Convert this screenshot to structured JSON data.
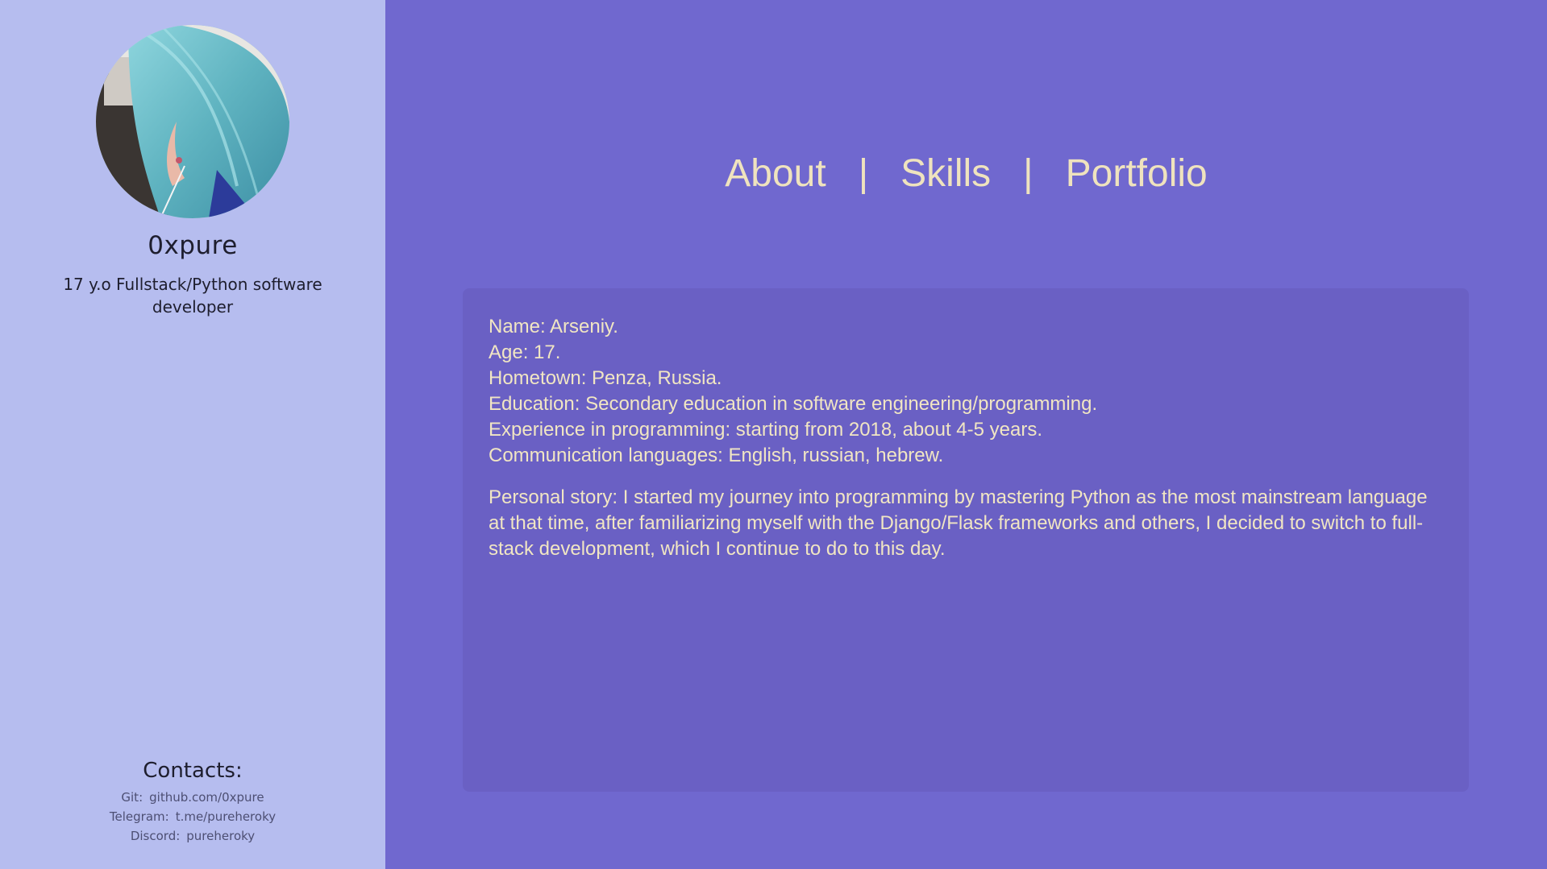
{
  "profile": {
    "username": "0xpure",
    "tagline": "17 y.o Fullstack/Python software developer"
  },
  "contacts": {
    "title": "Contacts:",
    "items": [
      {
        "label": "Git:",
        "value": "github.com/0xpure"
      },
      {
        "label": "Telegram:",
        "value": "t.me/pureheroky"
      },
      {
        "label": "Discord:",
        "value": "pureheroky"
      }
    ]
  },
  "nav": {
    "items": [
      "About",
      "Skills",
      "Portfolio"
    ],
    "separator": "|"
  },
  "about": {
    "lines": [
      "Name: Arseniy.",
      "Age: 17.",
      "Hometown: Penza, Russia.",
      "Education: Secondary education in software engineering/programming.",
      "Experience in programming: starting from 2018, about 4-5 years.",
      "Communication languages: English, russian, hebrew."
    ],
    "story": "Personal story: I started my journey into programming by mastering Python as the most mainstream language at that time, after familiarizing myself with the Django/Flask frameworks and others, I decided to switch to full-stack development, which I continue to do to this day."
  },
  "colors": {
    "sidebar_bg": "#b6bdef",
    "main_bg": "#7068cf",
    "card_bg": "#6a60c4",
    "accent_text": "#efe3be"
  }
}
